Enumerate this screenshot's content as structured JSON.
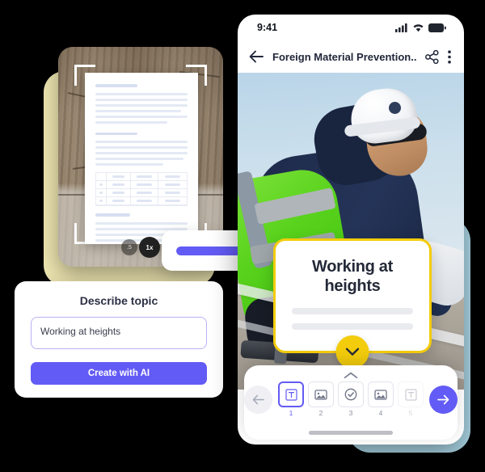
{
  "theme": {
    "accent_purple": "#635BF5",
    "accent_yellow": "#F3CC0C",
    "blob_yellow": "#EDE5B0",
    "blob_blue": "#AEDAEA",
    "text_dark": "#242938"
  },
  "scanner": {
    "name": "document-scanner-preview",
    "zoom_levels": [
      {
        "label": ".5",
        "active": false
      },
      {
        "label": "1x",
        "active": true
      }
    ]
  },
  "progress": {
    "name": "ai-generation-progress",
    "percent": 70
  },
  "topic_card": {
    "title": "Describe topic",
    "input_value": "Working at heights",
    "input_placeholder": "Describe topic",
    "button_label": "Create with AI"
  },
  "phone": {
    "status_bar": {
      "time": "9:41",
      "icons": [
        "signal-icon",
        "wifi-icon",
        "battery-icon"
      ]
    },
    "app_bar": {
      "back_icon": "arrow-left-icon",
      "title": "Foreign Material Prevention...",
      "share_icon": "share-icon",
      "menu_icon": "more-vertical-icon"
    },
    "slide": {
      "title": "Working at heights",
      "expand_icon": "chevron-down-icon"
    },
    "toolbar": {
      "collapse_icon": "chevron-up-icon",
      "prev_icon": "arrow-left-icon",
      "next_icon": "arrow-right-icon",
      "slides": [
        {
          "number": "1",
          "icon": "text-slide-icon",
          "selected": true,
          "faded": false
        },
        {
          "number": "2",
          "icon": "image-slide-icon",
          "selected": false,
          "faded": false
        },
        {
          "number": "3",
          "icon": "check-slide-icon",
          "selected": false,
          "faded": false
        },
        {
          "number": "4",
          "icon": "image-slide-icon",
          "selected": false,
          "faded": false
        },
        {
          "number": "5",
          "icon": "text-slide-icon",
          "selected": false,
          "faded": true
        }
      ]
    }
  }
}
